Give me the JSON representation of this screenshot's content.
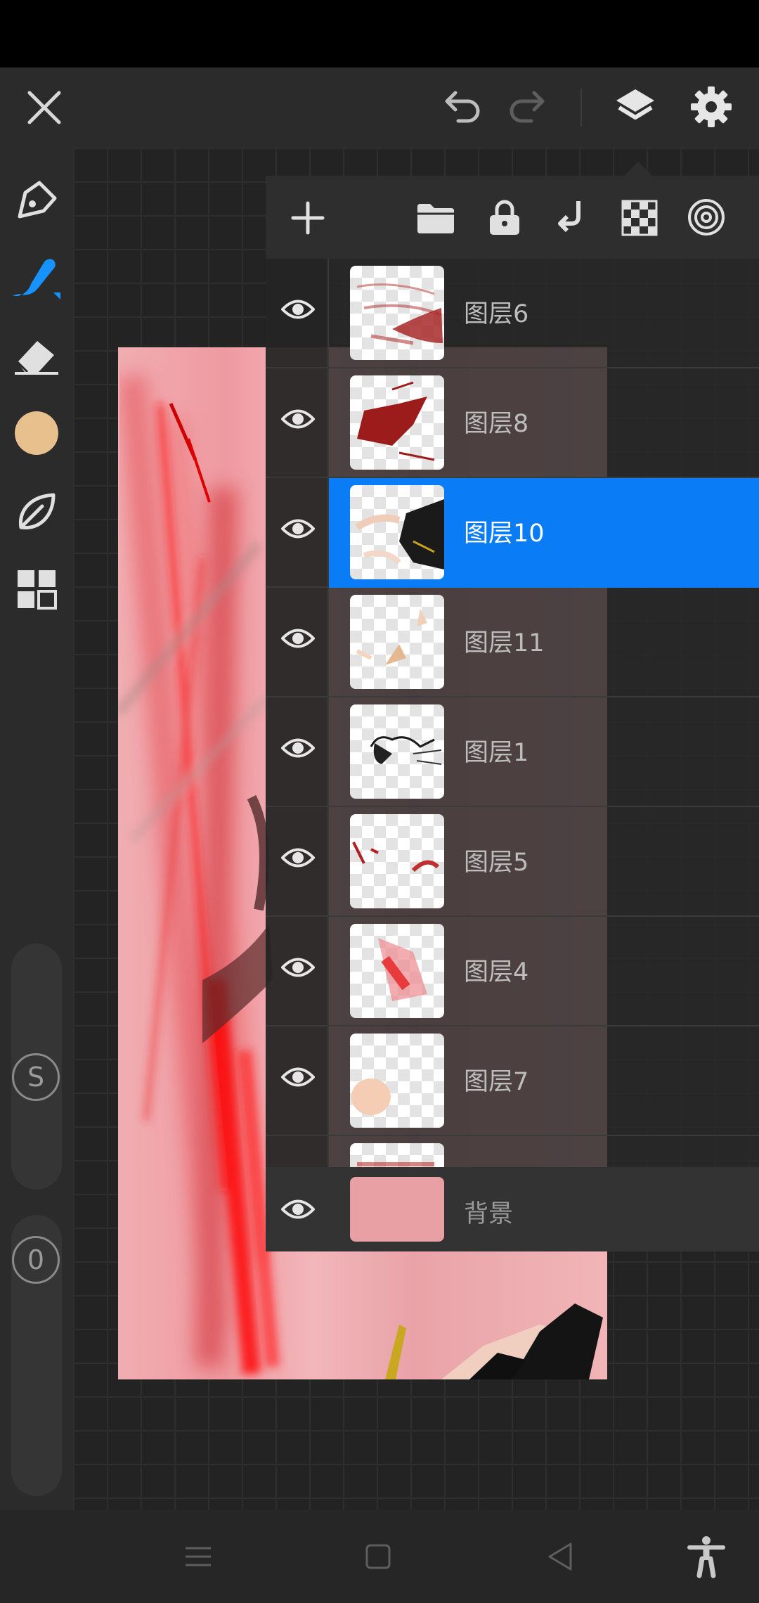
{
  "top_bar": {
    "close_icon": "close-icon",
    "undo_icon": "undo-icon",
    "redo_icon": "redo-icon",
    "layers_icon": "layers-icon",
    "settings_icon": "gear-icon"
  },
  "side_tools": [
    {
      "name": "pen-tool-icon",
      "active": false
    },
    {
      "name": "brush-tool-icon",
      "active": true
    },
    {
      "name": "eraser-tool-icon",
      "active": false
    },
    {
      "name": "color-swatch",
      "color": "#e8c08e"
    },
    {
      "name": "smudge-leaf-icon",
      "active": false
    },
    {
      "name": "grid-apps-icon",
      "active": false
    }
  ],
  "sliders": {
    "size_label": "S",
    "opacity_label": "0"
  },
  "layer_panel": {
    "toolbar_icons": [
      "add-layer-icon",
      "folder-icon",
      "lock-icon",
      "merge-down-icon",
      "transparency-checker-icon",
      "target-icon"
    ],
    "layers": [
      {
        "name": "图层6",
        "active": false,
        "visible": true
      },
      {
        "name": "图层8",
        "active": false,
        "visible": true
      },
      {
        "name": "图层10",
        "active": true,
        "visible": true
      },
      {
        "name": "图层11",
        "active": false,
        "visible": true
      },
      {
        "name": "图层1",
        "active": false,
        "visible": true
      },
      {
        "name": "图层5",
        "active": false,
        "visible": true
      },
      {
        "name": "图层4",
        "active": false,
        "visible": true
      },
      {
        "name": "图层7",
        "active": false,
        "visible": true
      }
    ],
    "background_layer": {
      "name": "背景",
      "color": "#e9a0a4"
    }
  },
  "colors": {
    "accent": "#0a7cf5",
    "app_background": "#2b2b2b"
  },
  "bottom_nav": [
    "menu-icon",
    "home-square-icon",
    "back-triangle-icon",
    "accessibility-icon"
  ]
}
